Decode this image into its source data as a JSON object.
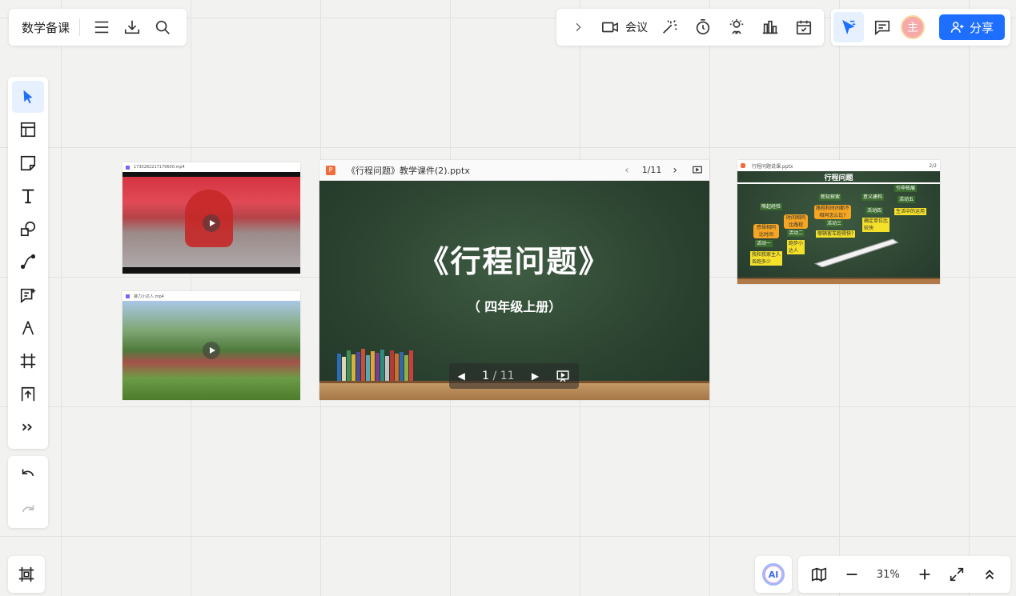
{
  "header": {
    "board_title": "数学备课",
    "meeting_label": "会议",
    "share_label": "分享",
    "avatar_text": "主"
  },
  "colors": {
    "accent": "#1e6fff",
    "avatar": "#f5a9a9",
    "chalkboard": "#2c4431"
  },
  "canvas": {
    "video1": {
      "title": "1730282217179600.mp4"
    },
    "video2": {
      "title": "接力小达人.mp4"
    },
    "ppt_main": {
      "filename": "《行程问题》教学课件(2).pptx",
      "page_indicator": "1/11",
      "slide_title": "《行程问题》",
      "slide_subtitle": "（ 四年级上册）",
      "pager_current": "1",
      "pager_sep": "/",
      "pager_total": "11"
    },
    "ppt_side": {
      "filename": "行程问题说课.pptx",
      "page_indicator": "2/2",
      "slide_title": "行程问题",
      "tags": [
        "唤起经验",
        "新知探索",
        "意义建构",
        "引申拓展",
        "感悟相同比时间",
        "时间相同比路程",
        "路程和时间都不相同怎么比?",
        "活动一",
        "活动二",
        "活动三",
        "活动四",
        "活动五",
        "我和我家主人各跑多少",
        "跑步小达人",
        "哪辆客车跑得快?",
        "确定单位比较快",
        "生活中的运用"
      ]
    }
  },
  "zoom": {
    "value": "31%"
  },
  "ai_label": "AI",
  "icons": [
    "menu-icon",
    "download-icon",
    "search-icon",
    "chevron-right-icon",
    "video-camera-icon",
    "magic-wand-icon",
    "timer-icon",
    "spotlight-icon",
    "bar-chart-icon",
    "calendar-check-icon",
    "laser-pointer-icon",
    "comment-icon",
    "user-add-icon",
    "select-arrow-icon",
    "template-icon",
    "sticky-note-icon",
    "text-icon",
    "shapes-icon",
    "connector-icon",
    "add-text-icon",
    "pen-icon",
    "frame-icon",
    "upload-icon",
    "more-icon",
    "undo-icon",
    "redo-icon",
    "map-icon",
    "zoom-out-icon",
    "zoom-in-icon",
    "fullscreen-icon",
    "collapse-up-icon"
  ]
}
